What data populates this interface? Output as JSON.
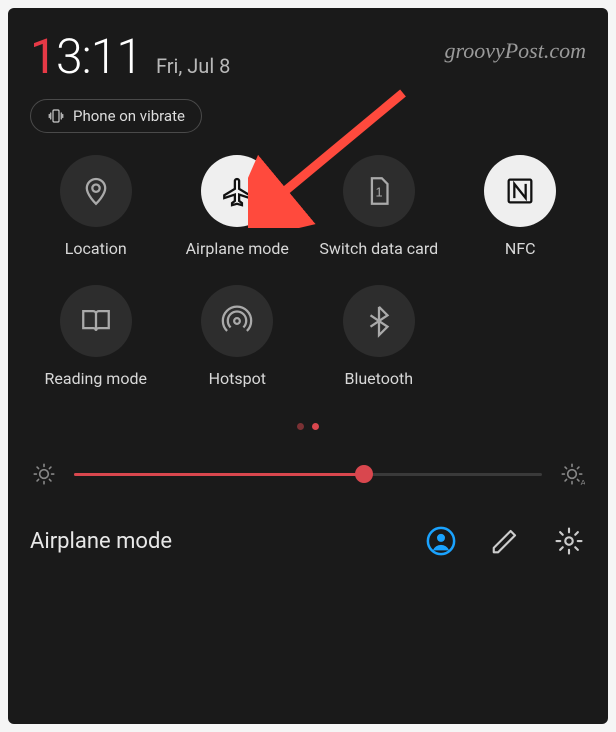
{
  "clock": {
    "hour_first": "1",
    "rest": "3:11"
  },
  "date": "Fri, Jul 8",
  "watermark": "groovyPost.com",
  "status_chip": {
    "label": "Phone on vibrate"
  },
  "tiles": [
    {
      "id": "location",
      "label": "Location",
      "active": false
    },
    {
      "id": "airplane",
      "label": "Airplane mode",
      "active": true
    },
    {
      "id": "switchdata",
      "label": "Switch data card",
      "active": false
    },
    {
      "id": "nfc",
      "label": "NFC",
      "active": true
    },
    {
      "id": "reading",
      "label": "Reading mode",
      "active": false
    },
    {
      "id": "hotspot",
      "label": "Hotspot",
      "active": false
    },
    {
      "id": "bluetooth",
      "label": "Bluetooth",
      "active": false
    }
  ],
  "brightness": {
    "percent": 62
  },
  "footer": {
    "title": "Airplane mode"
  },
  "colors": {
    "accent": "#d9474e",
    "active_bg": "#efefef",
    "tile_bg": "#2d2d2d",
    "user_ring": "#1aa3ff"
  }
}
